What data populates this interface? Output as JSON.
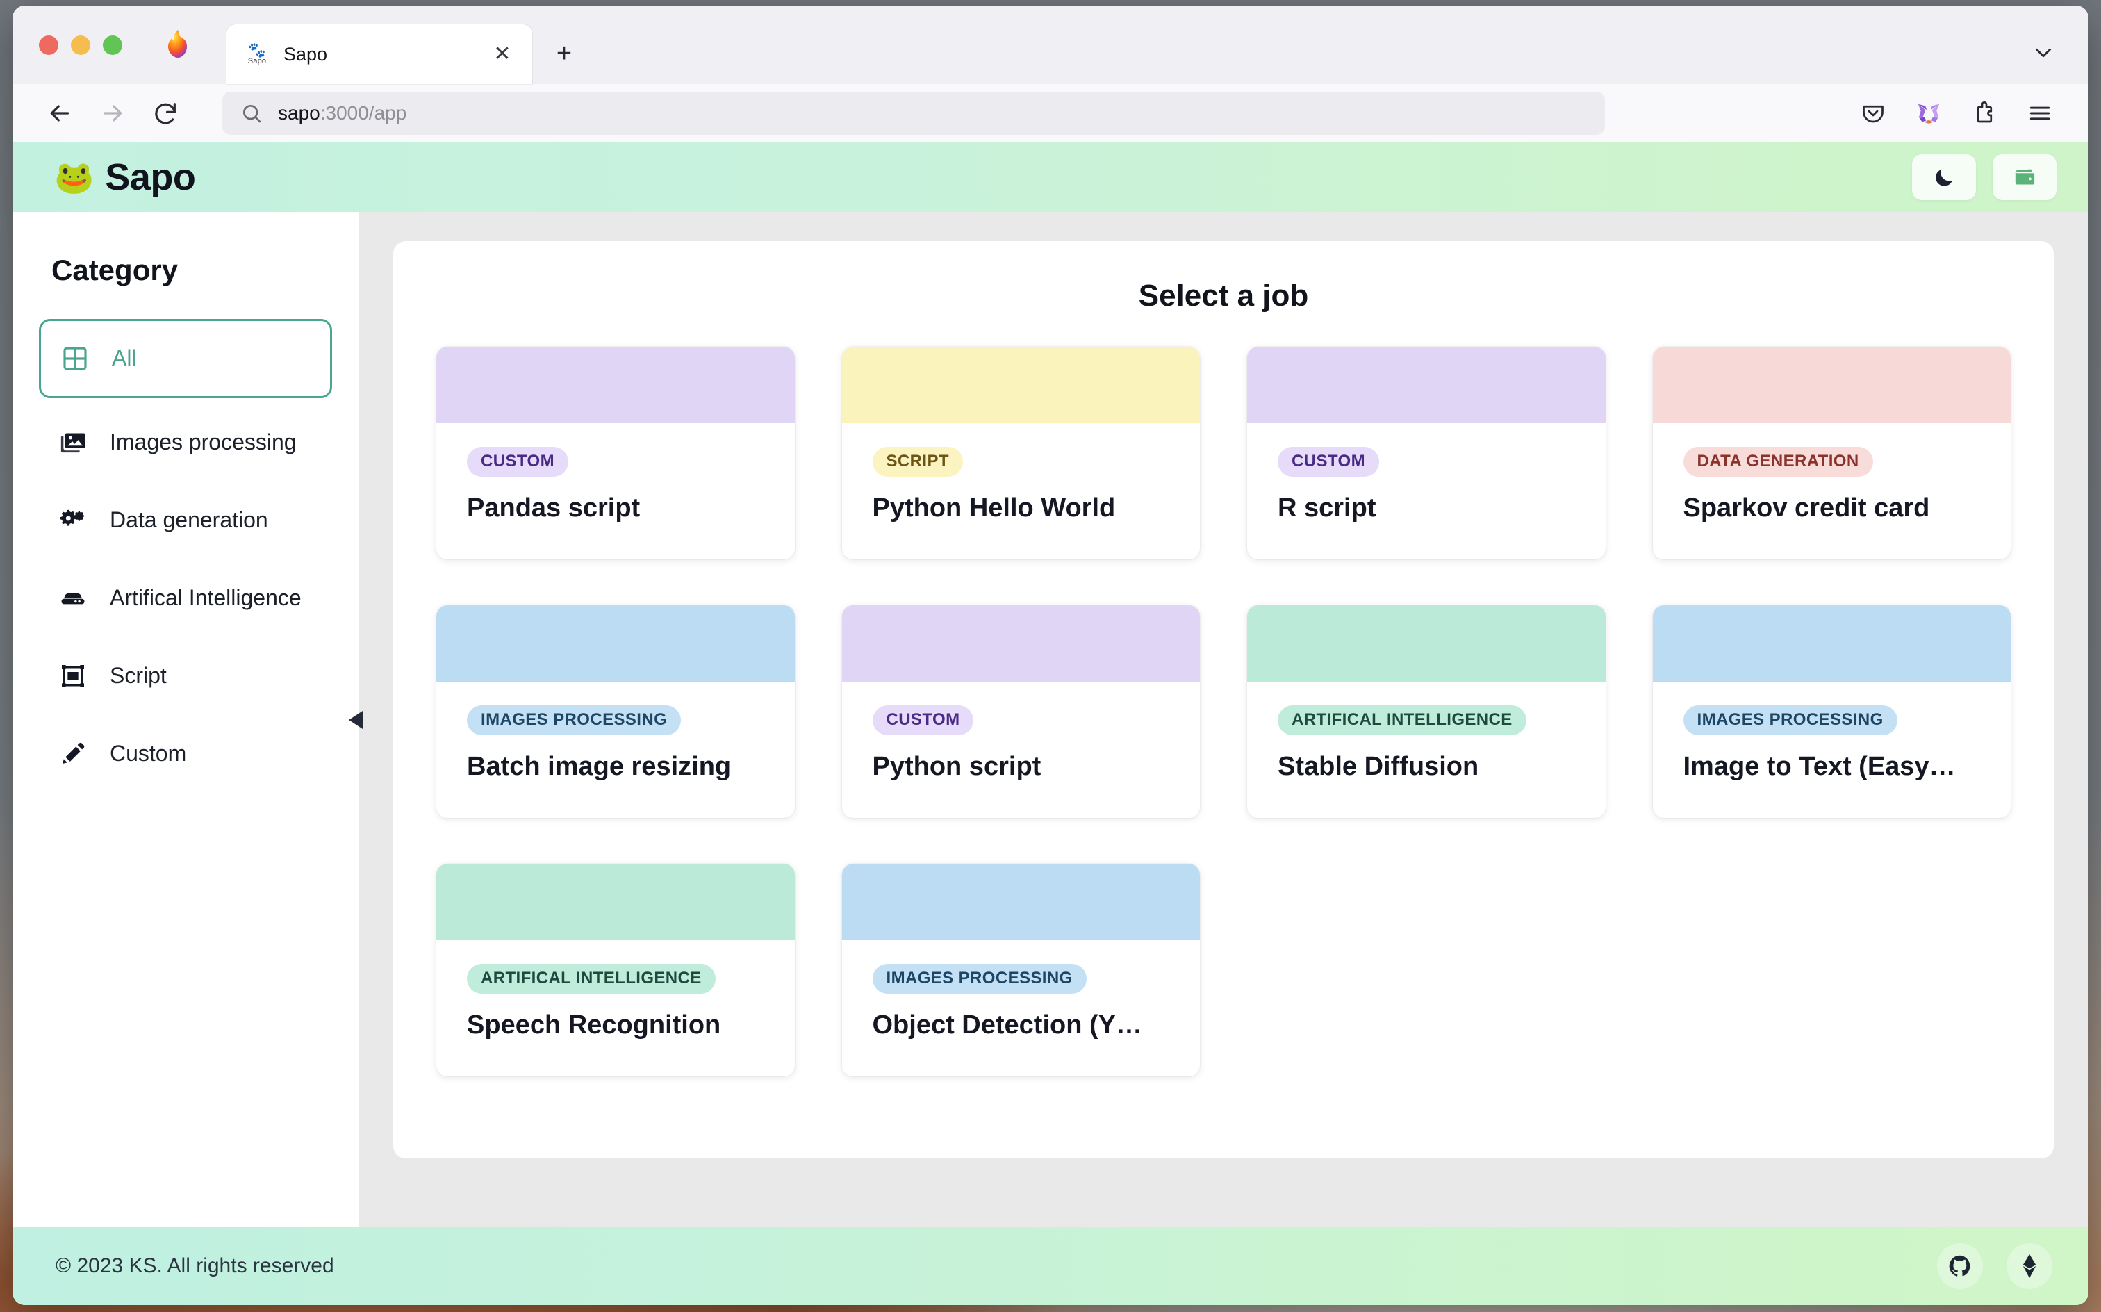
{
  "browser": {
    "tab": {
      "title": "Sapo",
      "favicon_label": "Sapo",
      "close_label": "✕"
    },
    "new_tab_label": "+",
    "url": {
      "host": "sapo",
      "rest": ":3000/app",
      "full": "sapo:3000/app"
    },
    "toolbar_icons": [
      "back-arrow",
      "forward-arrow",
      "reload",
      "search-icon",
      "pocket-icon",
      "metamask-icon",
      "extensions-icon",
      "menu-icon"
    ]
  },
  "app": {
    "brand": {
      "emoji": "🐸",
      "name": "Sapo"
    },
    "header_buttons": [
      {
        "name": "dark-mode-toggle",
        "icon": "moon-icon"
      },
      {
        "name": "wallet-button",
        "icon": "wallet-icon"
      }
    ]
  },
  "sidebar": {
    "title": "Category",
    "items": [
      {
        "label": "All",
        "icon": "grid-icon",
        "active": true
      },
      {
        "label": "Images processing",
        "icon": "images-icon",
        "active": false
      },
      {
        "label": "Data generation",
        "icon": "gears-icon",
        "active": false
      },
      {
        "label": "Artifical Intelligence",
        "icon": "server-icon",
        "active": false
      },
      {
        "label": "Script",
        "icon": "script-icon",
        "active": false
      },
      {
        "label": "Custom",
        "icon": "pencil-icon",
        "active": false
      }
    ],
    "collapse_icon": "triangle-left-icon"
  },
  "main": {
    "title": "Select a job",
    "jobs": [
      {
        "tag": "CUSTOM",
        "title": "Pandas script",
        "thumb": "#e0d5f5",
        "tag_bg": "#e6dbf8",
        "tag_fg": "#4b2a86"
      },
      {
        "tag": "SCRIPT",
        "title": "Python Hello World",
        "thumb": "#faf3bb",
        "tag_bg": "#fbf4c0",
        "tag_fg": "#6b5415"
      },
      {
        "tag": "CUSTOM",
        "title": "R script",
        "thumb": "#e0d5f5",
        "tag_bg": "#e6dbf8",
        "tag_fg": "#4b2a86"
      },
      {
        "tag": "DATA GENERATION",
        "title": "Sparkov credit card",
        "thumb": "#f7d9d7",
        "tag_bg": "#f8dcda",
        "tag_fg": "#8b322c"
      },
      {
        "tag": "IMAGES PROCESSING",
        "title": "Batch image resizing",
        "thumb": "#bcdcf3",
        "tag_bg": "#c3e0f5",
        "tag_fg": "#1d4664"
      },
      {
        "tag": "CUSTOM",
        "title": "Python script",
        "thumb": "#e0d5f5",
        "tag_bg": "#e6dbf8",
        "tag_fg": "#4b2a86"
      },
      {
        "tag": "ARTIFICAL INTELLIGENCE",
        "title": "Stable Diffusion",
        "thumb": "#bcead9",
        "tag_bg": "#bfecdb",
        "tag_fg": "#1d4a3f"
      },
      {
        "tag": "IMAGES PROCESSING",
        "title": "Image to Text (Easy…",
        "thumb": "#bcdcf3",
        "tag_bg": "#c3e0f5",
        "tag_fg": "#1d4664"
      },
      {
        "tag": "ARTIFICAL INTELLIGENCE",
        "title": "Speech Recognition",
        "thumb": "#bcead9",
        "tag_bg": "#bfecdb",
        "tag_fg": "#1d4a3f"
      },
      {
        "tag": "IMAGES PROCESSING",
        "title": "Object Detection (Y…",
        "thumb": "#bcdcf3",
        "tag_bg": "#c3e0f5",
        "tag_fg": "#1d4664"
      }
    ]
  },
  "footer": {
    "copyright": "© 2023 KS. All rights reserved",
    "links": [
      {
        "name": "github-link",
        "icon": "github-icon"
      },
      {
        "name": "ethereum-link",
        "icon": "ethereum-icon"
      }
    ]
  },
  "colors": {
    "header_gradient_start": "#c3f1e0",
    "header_gradient_end": "#cff4c9",
    "accent": "#4aa58f",
    "page_bg": "#e9e9e9",
    "text": "#12141d"
  }
}
